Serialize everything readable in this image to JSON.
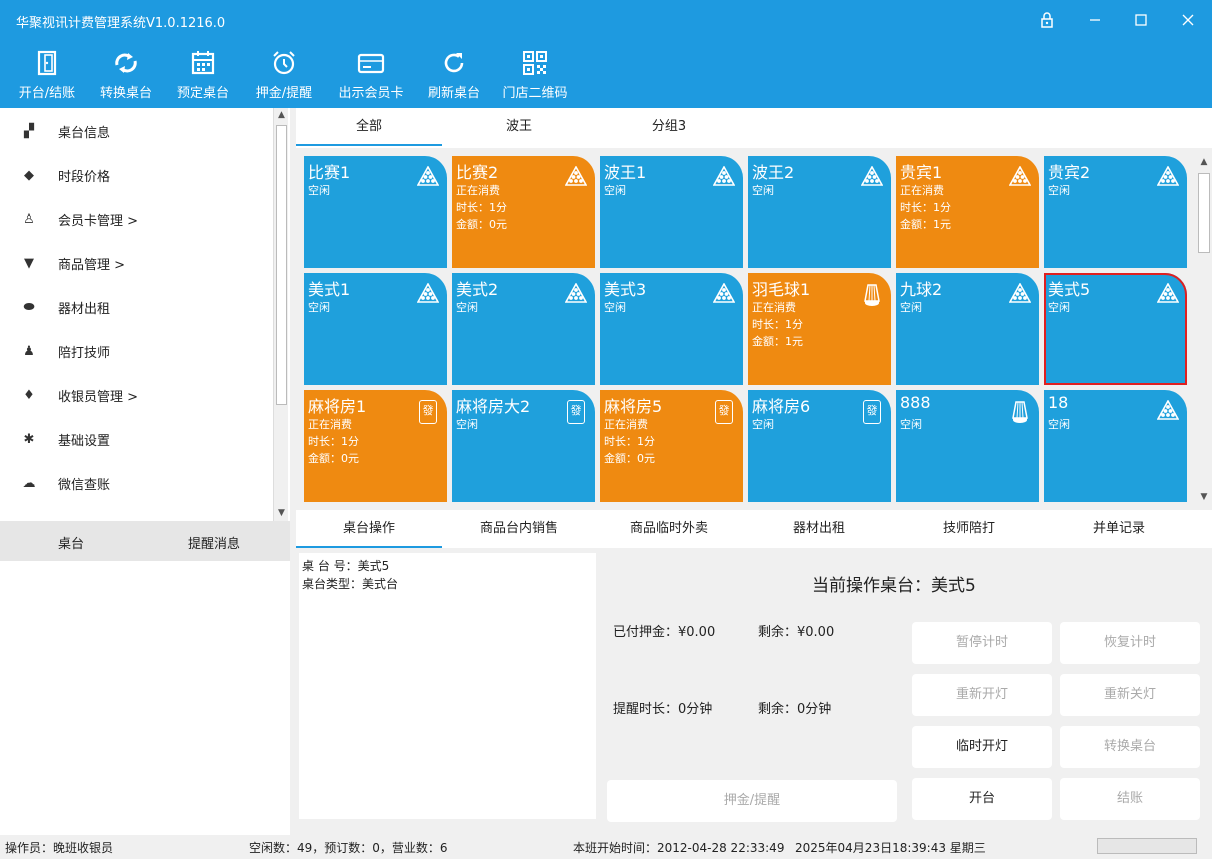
{
  "app": {
    "title": "华聚视讯计费管理系统V1.0.1216.0"
  },
  "toolbar": [
    {
      "label": "开台/结账",
      "icon": "door-icon"
    },
    {
      "label": "转换桌台",
      "icon": "swap-icon"
    },
    {
      "label": "预定桌台",
      "icon": "calendar-icon"
    },
    {
      "label": "押金/提醒",
      "icon": "alarm-clock-icon"
    },
    {
      "label": "出示会员卡",
      "icon": "card-icon"
    },
    {
      "label": "刷新桌台",
      "icon": "refresh-icon"
    },
    {
      "label": "门店二维码",
      "icon": "qrcode-icon"
    }
  ],
  "sidebar": {
    "items": [
      {
        "label": "桌台信息",
        "icon": "table-info-icon"
      },
      {
        "label": "时段价格",
        "icon": "price-tag-icon"
      },
      {
        "label": "会员卡管理  >",
        "icon": "user-icon"
      },
      {
        "label": "商品管理  >",
        "icon": "cart-icon"
      },
      {
        "label": "器材出租",
        "icon": "gamepad-icon"
      },
      {
        "label": "陪打技师",
        "icon": "person-icon"
      },
      {
        "label": "收银员管理  >",
        "icon": "money-bag-icon"
      },
      {
        "label": "基础设置",
        "icon": "gear-icon"
      },
      {
        "label": "微信查账",
        "icon": "cloud-icon"
      }
    ],
    "bottom_tabs": [
      "桌台",
      "提醒消息"
    ]
  },
  "group_tabs": [
    "全部",
    "波王",
    "分组3"
  ],
  "tiles": [
    {
      "name": "比赛1",
      "status": "空闲",
      "type": "billiard",
      "busy": false
    },
    {
      "name": "比赛2",
      "status": "正在消费",
      "duration": "时长：1分",
      "amount": "金额：0元",
      "type": "billiard",
      "busy": true
    },
    {
      "name": "波王1",
      "status": "空闲",
      "type": "billiard",
      "busy": false
    },
    {
      "name": "波王2",
      "status": "空闲",
      "type": "billiard",
      "busy": false
    },
    {
      "name": "贵宾1",
      "status": "正在消费",
      "duration": "时长：1分",
      "amount": "金额：1元",
      "type": "billiard",
      "busy": true
    },
    {
      "name": "贵宾2",
      "status": "空闲",
      "type": "billiard",
      "busy": false
    },
    {
      "name": "美式1",
      "status": "空闲",
      "type": "billiard",
      "busy": false
    },
    {
      "name": "美式2",
      "status": "空闲",
      "type": "billiard",
      "busy": false
    },
    {
      "name": "美式3",
      "status": "空闲",
      "type": "billiard",
      "busy": false
    },
    {
      "name": "羽毛球1",
      "status": "正在消费",
      "duration": "时长：1分",
      "amount": "金额：1元",
      "type": "shuttlecock",
      "busy": true
    },
    {
      "name": "九球2",
      "status": "空闲",
      "type": "billiard",
      "busy": false
    },
    {
      "name": "美式5",
      "status": "空闲",
      "type": "billiard",
      "busy": false,
      "selected": true
    },
    {
      "name": "麻将房1",
      "status": "正在消费",
      "duration": "时长：1分",
      "amount": "金额：0元",
      "type": "mahjong",
      "busy": true
    },
    {
      "name": "麻将房大2",
      "status": "空闲",
      "type": "mahjong",
      "busy": false
    },
    {
      "name": "麻将房5",
      "status": "正在消费",
      "duration": "时长：1分",
      "amount": "金额：0元",
      "type": "mahjong",
      "busy": true
    },
    {
      "name": "麻将房6",
      "status": "空闲",
      "type": "mahjong",
      "busy": false
    },
    {
      "name": "888",
      "status": "空闲",
      "type": "shuttlecock",
      "busy": false
    },
    {
      "name": "18",
      "status": "空闲",
      "type": "billiard",
      "busy": false
    }
  ],
  "mahjong_glyph": "發",
  "op_tabs": [
    "桌台操作",
    "商品台内销售",
    "商品临时外卖",
    "器材出租",
    "技师陪打",
    "并单记录"
  ],
  "info": {
    "table_no": "桌 台 号：美式5",
    "table_type": "桌台类型：美式台"
  },
  "ops": {
    "current": "当前操作桌台：美式5",
    "deposit_paid": "已付押金：¥0.00",
    "deposit_left": "剩余：¥0.00",
    "remind_duration": "提醒时长：0分钟",
    "remind_left": "剩余：0分钟",
    "deposit_button": "押金/提醒",
    "pause": "暂停计时",
    "resume": "恢复计时",
    "relight": "重新开灯",
    "reoff": "重新关灯",
    "temp_light": "临时开灯",
    "switch_table": "转换桌台",
    "open": "开台",
    "checkout": "结账"
  },
  "status": {
    "operator": "操作员：晚班收银员",
    "counts": "空闲数：49，预订数：0，营业数：6",
    "shift_start": "本班开始时间：2012-04-28 22:33:49",
    "now": "2025年04月23日18:39:43 星期三"
  },
  "colors": {
    "accent": "#1e9ae0",
    "free": "#1fa0dc",
    "busy": "#ef8a11",
    "selected_border": "#e02020"
  }
}
